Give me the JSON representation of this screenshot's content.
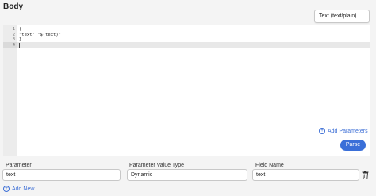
{
  "body_section": {
    "title": "Body",
    "content_type": "Text (text/plain)"
  },
  "editor": {
    "line_numbers": [
      "1",
      "2",
      "3",
      "4"
    ],
    "lines": [
      "{",
      "\"text\":\"$(text)\"",
      "}",
      ""
    ]
  },
  "actions": {
    "add_parameters": "Add Parameters",
    "parse": "Parse",
    "add_new": "Add New"
  },
  "parameters_table": {
    "headers": {
      "parameter": "Parameter",
      "value_type": "Parameter Value Type",
      "field_name": "Field Name"
    },
    "row": {
      "parameter": "text",
      "value_type": "Dynamic",
      "field_name": "text"
    }
  },
  "colors": {
    "accent": "#3a6fd8"
  },
  "icons": {
    "add": "plus-circle-icon",
    "delete": "trash-icon"
  }
}
